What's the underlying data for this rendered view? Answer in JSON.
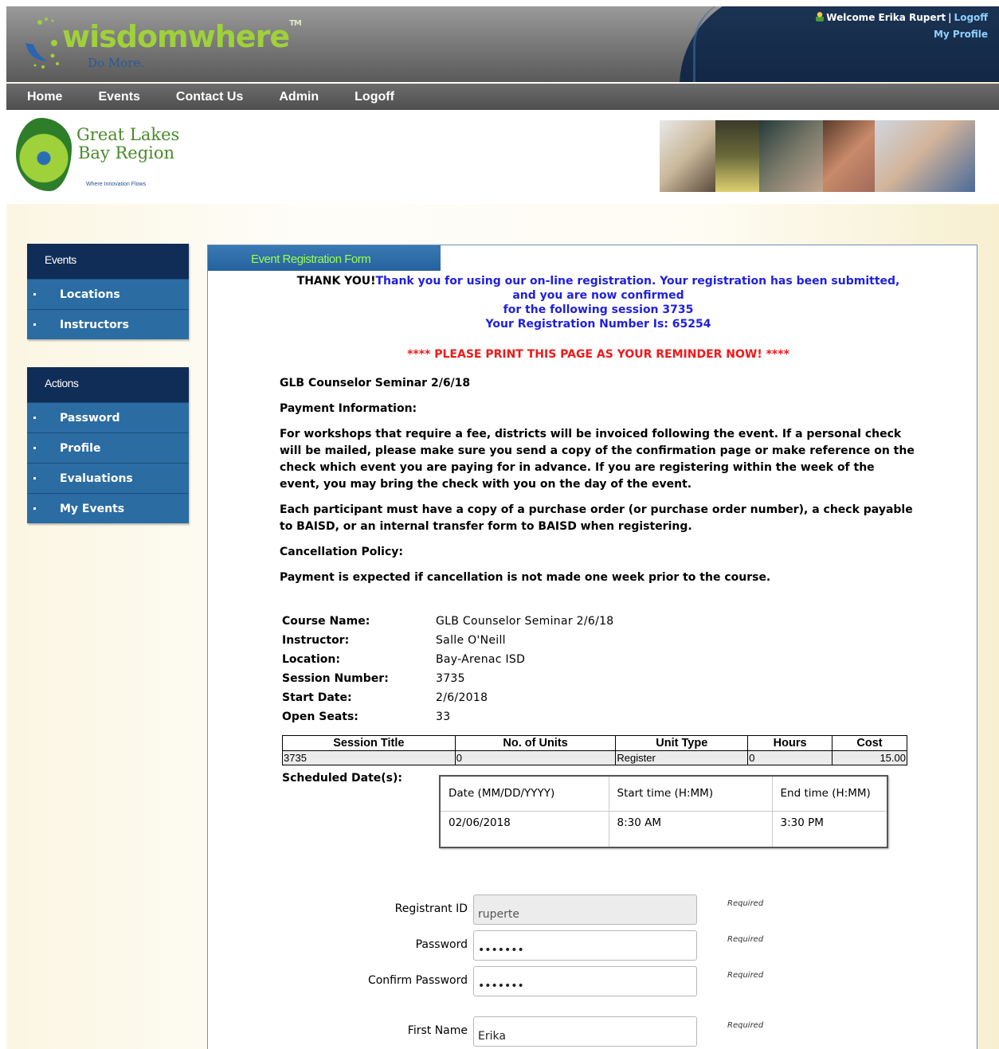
{
  "header": {
    "logo_text": "wisdomwhere",
    "logo_tagline": "Do More.",
    "welcome": "Welcome Erika Rupert",
    "separator": "|",
    "logoff": "Logoff",
    "my_profile": "My Profile"
  },
  "nav": [
    "Home",
    "Events",
    "Contact Us",
    "Admin",
    "Logoff"
  ],
  "banner": {
    "org_line1": "Great Lakes",
    "org_line2": "Bay Region",
    "org_tagline": "Where Innovation Flows"
  },
  "sidebar": {
    "events_title": "Events",
    "events_items": [
      "Locations",
      "Instructors"
    ],
    "actions_title": "Actions",
    "actions_items": [
      "Password",
      "Profile",
      "Evaluations",
      "My Events"
    ]
  },
  "panel": {
    "tab_title": "Event Registration Form",
    "thanks_bold": "THANK YOU!",
    "thanks_line1": "Thank you for using our on-line registration. Your registration has been submitted,",
    "thanks_line2": "and you are now confirmed",
    "thanks_line3": "for the following session 3735",
    "thanks_line4": "Your Registration Number Is: 65254",
    "print_note": "**** PLEASE PRINT THIS PAGE AS YOUR REMINDER NOW! ****",
    "event_title": "GLB Counselor Seminar 2/6/18",
    "payment_heading": "Payment Information:",
    "payment_text": "For workshops that require a fee, districts will be invoiced following the event. If a personal check will be mailed, please make sure you send a copy of the confirmation page or make reference on the check which event you are paying for in advance. If you are registering within the week of the event, you may bring the check with you on the day of the event.",
    "po_text": "Each participant must have a copy of a purchase order (or purchase order number), a check payable to BAISD, or an internal transfer form to BAISD when registering.",
    "cancel_heading": "Cancellation Policy:",
    "cancel_text": "Payment is expected if cancellation is not made one week prior to the course."
  },
  "details": [
    {
      "label": "Course Name:",
      "value": "GLB Counselor Seminar 2/6/18"
    },
    {
      "label": "Instructor:",
      "value": "Salle O'Neill"
    },
    {
      "label": "Location:",
      "value": "Bay-Arenac ISD"
    },
    {
      "label": "Session Number:",
      "value": "3735"
    },
    {
      "label": "Start Date:",
      "value": "2/6/2018"
    },
    {
      "label": "Open Seats:",
      "value": "33"
    }
  ],
  "units_table": {
    "headers": [
      "Session Title",
      "No. of Units",
      "Unit Type",
      "Hours",
      "Cost"
    ],
    "row": [
      "3735",
      "0",
      "Register",
      "0",
      "15.00"
    ]
  },
  "schedule": {
    "label": "Scheduled Date(s):",
    "headers": [
      "Date (MM/DD/YYYY)",
      "Start time (H:MM)",
      "End time (H:MM)"
    ],
    "row": [
      "02/06/2018",
      "8:30 AM",
      "3:30 PM"
    ]
  },
  "form": {
    "required": "Required",
    "fields": [
      {
        "label": "Registrant ID",
        "value": "ruperte"
      },
      {
        "label": "Password",
        "value": "•••••••"
      },
      {
        "label": "Confirm Password",
        "value": "•••••••"
      },
      {
        "label": "First Name",
        "value": "Erika"
      }
    ]
  }
}
